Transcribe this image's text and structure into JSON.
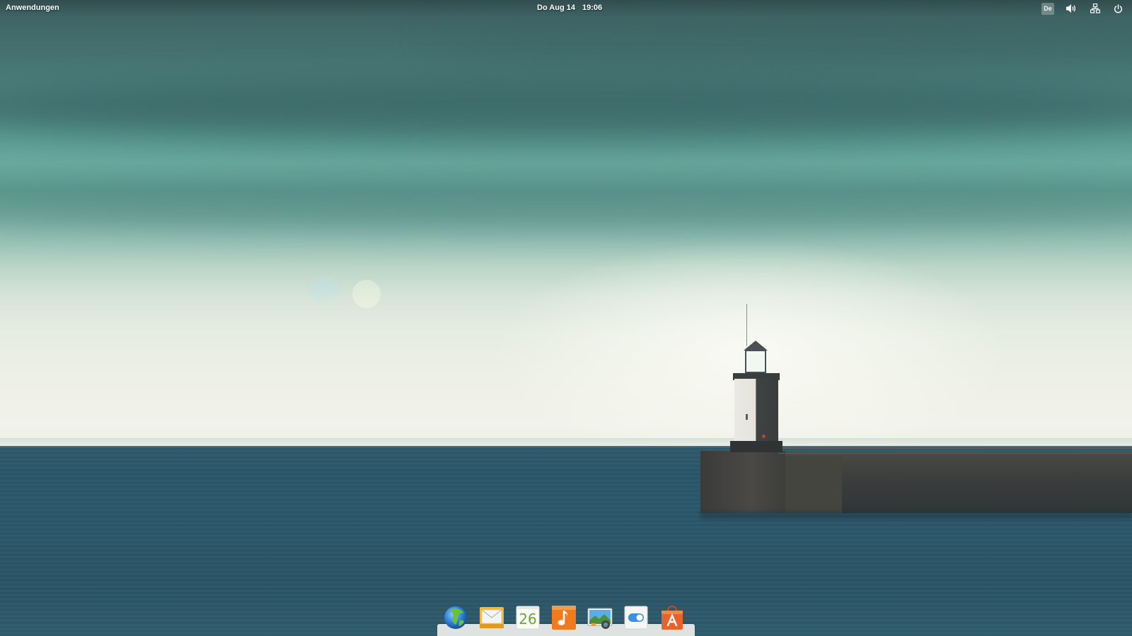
{
  "panel": {
    "applications_label": "Anwendungen",
    "date": "Do Aug 14",
    "time": "19:06",
    "keyboard_layout": "De",
    "indicators": [
      "keyboard-layout-icon",
      "volume-icon",
      "network-icon",
      "power-icon"
    ]
  },
  "dock": {
    "items": [
      {
        "app": "web-browser",
        "icon": "globe-icon"
      },
      {
        "app": "mail",
        "icon": "envelope-icon"
      },
      {
        "app": "calendar",
        "icon": "calendar-icon",
        "badge_text": "26"
      },
      {
        "app": "music",
        "icon": "music-note-icon"
      },
      {
        "app": "photos",
        "icon": "photo-camera-icon"
      },
      {
        "app": "system-settings",
        "icon": "toggle-switch-icon"
      },
      {
        "app": "app-center",
        "icon": "shopping-bag-icon"
      }
    ]
  },
  "colors": {
    "sky_top": "#3d5e60",
    "sky_horizon": "#eef0e7",
    "sea": "#2b566a",
    "calendar_number": "#6aa733",
    "music_orange": "#f07a1e",
    "appcenter_orange": "#e8632a"
  }
}
